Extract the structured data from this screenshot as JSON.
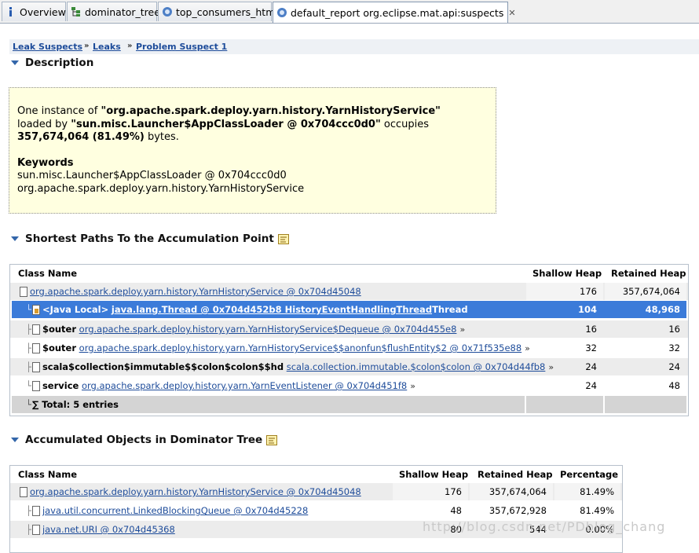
{
  "tabs": [
    {
      "label": "Overview",
      "icon": "info-icon"
    },
    {
      "label": "dominator_tree",
      "icon": "tree-icon"
    },
    {
      "label": "top_consumers_html",
      "icon": "report-icon"
    },
    {
      "label": "default_report  org.eclipse.mat.api:suspects",
      "icon": "report-icon",
      "close": "✕"
    }
  ],
  "breadcrumb": {
    "items": [
      "Leak Suspects",
      "Leaks",
      "Problem Suspect 1"
    ],
    "sep": "»"
  },
  "description": {
    "title": "Description",
    "line1_pre": "One instance of ",
    "line1_bold": "\"org.apache.spark.deploy.yarn.history.YarnHistoryService\"",
    "line2_pre": "loaded by ",
    "line2_bold": "\"sun.misc.Launcher$AppClassLoader @ 0x704ccc0d0\"",
    "line2_post": " occupies",
    "line3_bold": "357,674,064 (81.49%)",
    "line3_post": " bytes.",
    "keywords_title": "Keywords",
    "keyword1": "sun.misc.Launcher$AppClassLoader @ 0x704ccc0d0",
    "keyword2": "org.apache.spark.deploy.yarn.history.YarnHistoryService"
  },
  "paths": {
    "title": "Shortest Paths To the Accumulation Point",
    "headers": {
      "class": "Class Name",
      "shallow": "Shallow Heap",
      "retained": "Retained Heap"
    },
    "rows": [
      {
        "prefix": "",
        "link": "org.apache.spark.deploy.yarn.history.YarnHistoryService @ 0x704d45048",
        "suffix": "",
        "more": "",
        "shallow": "176",
        "retained": "357,674,064"
      },
      {
        "prefix": "<Java Local>",
        "link": "java.lang.Thread @ 0x704d452b8 HistoryEventHandlingThread",
        "suffix": " Thread",
        "more": "",
        "shallow": "104",
        "retained": "48,968"
      },
      {
        "prefix": "$outer",
        "link": "org.apache.spark.deploy.history.yarn.YarnHistoryService$Dequeue @ 0x704d455e8",
        "suffix": "",
        "more": "»",
        "shallow": "16",
        "retained": "16"
      },
      {
        "prefix": "$outer",
        "link": "org.apache.spark.deploy.history.yarn.YarnHistoryService$$anonfun$flushEntity$2 @ 0x71f535e88",
        "suffix": "",
        "more": "»",
        "shallow": "32",
        "retained": "32"
      },
      {
        "prefix": "scala$collection$immutable$$colon$colon$$hd",
        "link": "scala.collection.immutable.$colon$colon @ 0x704d44fb8",
        "suffix": "",
        "more": "»",
        "shallow": "24",
        "retained": "24"
      },
      {
        "prefix": "service",
        "link": "org.apache.spark.deploy.history.yarn.YarnEventListener @ 0x704d451f8",
        "suffix": "",
        "more": "»",
        "shallow": "24",
        "retained": "48"
      }
    ],
    "total": "Total: 5 entries",
    "sigma": "∑"
  },
  "dominator": {
    "title": "Accumulated Objects in Dominator Tree",
    "headers": {
      "class": "Class Name",
      "shallow": "Shallow Heap",
      "retained": "Retained Heap",
      "percentage": "Percentage"
    },
    "rows": [
      {
        "link": "org.apache.spark.deploy.yarn.history.YarnHistoryService @ 0x704d45048",
        "shallow": "176",
        "retained": "357,674,064",
        "percentage": "81.49%"
      },
      {
        "link": "java.util.concurrent.LinkedBlockingQueue @ 0x704d45228",
        "shallow": "48",
        "retained": "357,672,928",
        "percentage": "81.49%"
      },
      {
        "link": "java.net.URI @ 0x704d45368",
        "shallow": "80",
        "retained": "544",
        "percentage": "0.00%"
      }
    ]
  },
  "watermark": "http://blog.csdn.net/PDblog_chang"
}
